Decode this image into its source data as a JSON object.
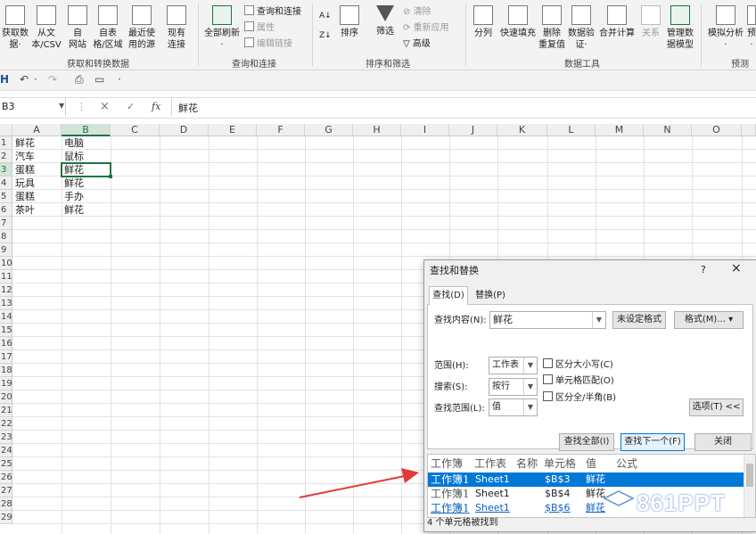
{
  "ribbon": {
    "buttons": [
      {
        "id": "get-data",
        "line1": "获取数",
        "line2": "据·"
      },
      {
        "id": "from-text",
        "line1": "从文",
        "line2": "本/CSV"
      },
      {
        "id": "from-web",
        "line1": "自",
        "line2": "网站"
      },
      {
        "id": "from-table",
        "line1": "自表",
        "line2": "格/区域"
      },
      {
        "id": "recent-sources",
        "line1": "最近使",
        "line2": "用的源"
      },
      {
        "id": "existing-conn",
        "line1": "现有",
        "line2": "连接"
      },
      {
        "id": "refresh-all",
        "line1": "全部刷新",
        "line2": "·"
      },
      {
        "id": "sort",
        "line1": "排序",
        "line2": ""
      },
      {
        "id": "filter",
        "line1": "筛选",
        "line2": ""
      },
      {
        "id": "split",
        "line1": "分列",
        "line2": ""
      },
      {
        "id": "flash-fill",
        "line1": "快速填充",
        "line2": ""
      },
      {
        "id": "remove-dup",
        "line1": "删除",
        "line2": "重复值"
      },
      {
        "id": "validation",
        "line1": "数据验",
        "line2": "证·"
      },
      {
        "id": "consolidate",
        "line1": "合并计算",
        "line2": ""
      },
      {
        "id": "relations",
        "line1": "关系",
        "line2": ""
      },
      {
        "id": "data-model",
        "line1": "管理数",
        "line2": "据模型"
      },
      {
        "id": "what-if",
        "line1": "模拟分析",
        "line2": "·"
      },
      {
        "id": "forecast",
        "line1": "预",
        "line2": "·"
      }
    ],
    "small": {
      "queries": "查询和连接",
      "properties": "属性",
      "edit_links": "编辑链接",
      "clear": "清除",
      "reapply": "重新应用",
      "advanced": "高级"
    },
    "groups": {
      "get_transform": "获取和转换数据",
      "queries_conn": "查询和连接",
      "sort_filter": "排序和筛选",
      "data_tools": "数据工具",
      "forecast": "预测"
    }
  },
  "qat": {
    "save": "H",
    "undo": "↶",
    "undo_dd": "·",
    "redo": "↷",
    "preview": "⎙",
    "more": "·"
  },
  "formula_bar": {
    "name_box": "B3",
    "cancel": "×",
    "enter": "✓",
    "fx": "fx",
    "content": "鲜花"
  },
  "grid": {
    "columns": [
      "A",
      "B",
      "C",
      "D",
      "E",
      "F",
      "G",
      "H",
      "I",
      "J",
      "K",
      "L",
      "M",
      "N",
      "O"
    ],
    "rows": [
      "1",
      "2",
      "3",
      "4",
      "5",
      "6",
      "7",
      "8",
      "9",
      "10",
      "11",
      "12",
      "13",
      "14",
      "15",
      "16",
      "17",
      "18",
      "19",
      "20",
      "21",
      "22",
      "23",
      "24",
      "25",
      "26",
      "27",
      "28",
      "29"
    ],
    "data": [
      [
        "鲜花",
        "电脑"
      ],
      [
        "汽车",
        "鼠标"
      ],
      [
        "蛋糕",
        "鲜花"
      ],
      [
        "玩具",
        "鲜花"
      ],
      [
        "蛋糕",
        "手办"
      ],
      [
        "茶叶",
        "鲜花"
      ]
    ]
  },
  "dialog": {
    "title": "查找和替换",
    "help": "?",
    "close": "×",
    "tabs": {
      "find": "查找(D)",
      "replace": "替换(P)"
    },
    "find_label": "查找内容(N):",
    "find_value": "鲜花",
    "no_format": "未设定格式",
    "format_btn": "格式(M)...",
    "scope_label": "范围(H):",
    "scope_value": "工作表",
    "search_label": "搜索(S):",
    "search_value": "按行",
    "lookin_label": "查找范围(L):",
    "lookin_value": "值",
    "opt_case": "区分大小写(C)",
    "opt_cell": "单元格匹配(O)",
    "opt_width": "区分全/半角(B)",
    "options_btn": "选项(T) <<",
    "find_all": "查找全部(I)",
    "find_next": "查找下一个(F)",
    "close_btn": "关闭",
    "results_headers": [
      "工作簿",
      "工作表",
      "名称",
      "单元格",
      "值",
      "公式"
    ],
    "results": [
      {
        "book": "工作簿1",
        "sheet": "Sheet1",
        "name": "",
        "cell": "$B$3",
        "value": "鲜花"
      },
      {
        "book": "工作簿1",
        "sheet": "Sheet1",
        "name": "",
        "cell": "$B$4",
        "value": "鲜花"
      },
      {
        "book": "工作簿1",
        "sheet": "Sheet1",
        "name": "",
        "cell": "$B$6",
        "value": "鲜花"
      }
    ],
    "status": "4 个单元格被找到"
  },
  "watermark": "861PPT",
  "colors": {
    "excel_green": "#217346",
    "selection_blue": "#0078d7",
    "arrow_red": "#e53935"
  }
}
